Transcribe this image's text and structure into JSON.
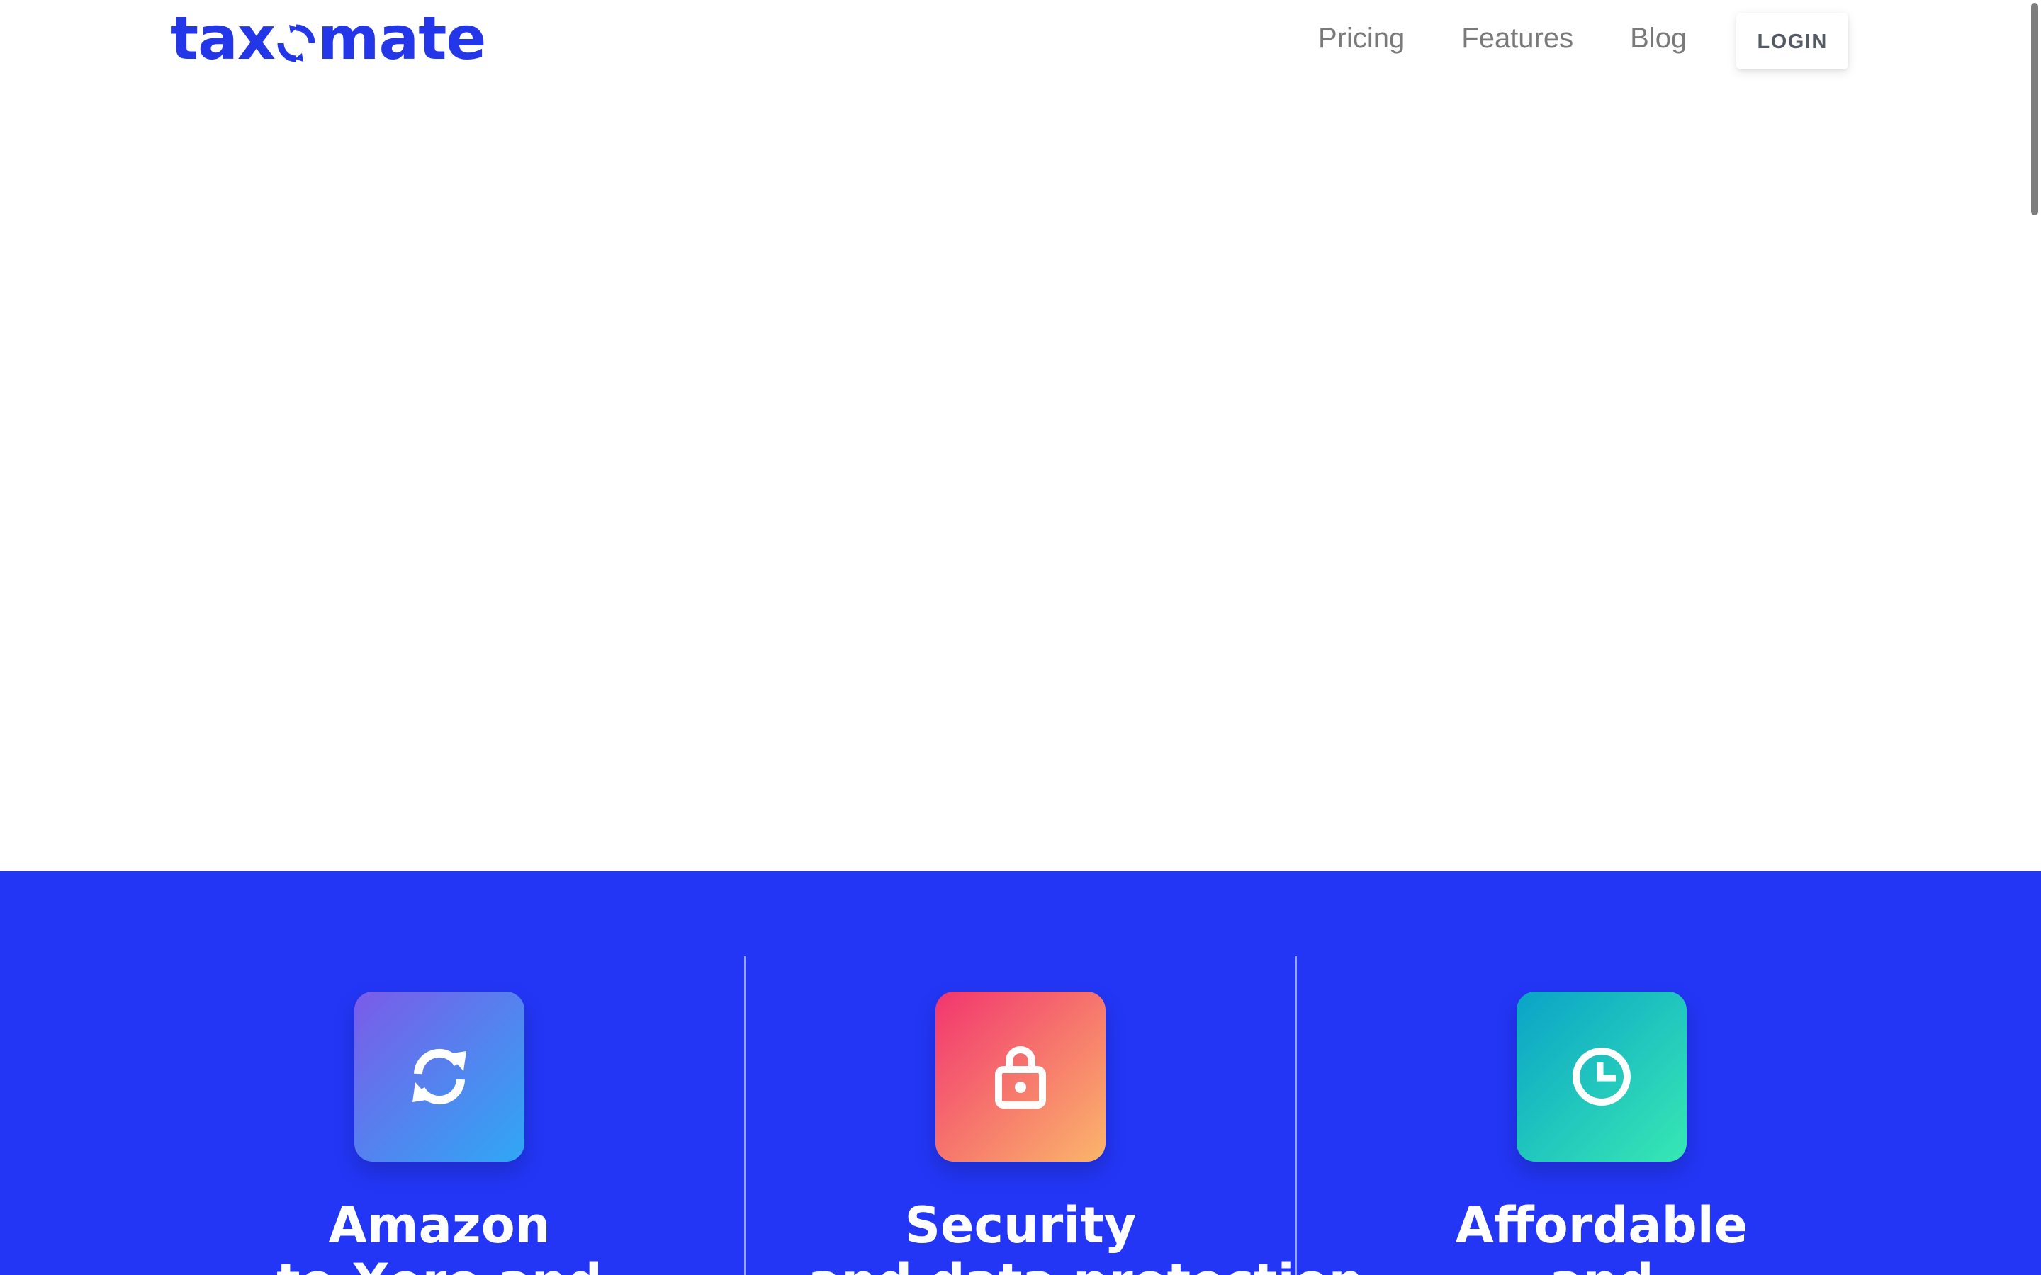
{
  "brand": {
    "logo_text_before": "tax",
    "logo_text_after": "mate",
    "color": "#2336e8"
  },
  "nav": {
    "items": [
      {
        "label": "Pricing"
      },
      {
        "label": "Features"
      },
      {
        "label": "Blog"
      }
    ],
    "login_label": "LOGIN"
  },
  "features": {
    "background": "#2336f5",
    "items": [
      {
        "title": "Amazon",
        "subtitle": "to Xero and",
        "icon": "sync-icon"
      },
      {
        "title": "Security",
        "subtitle": "and data protection",
        "icon": "lock-icon"
      },
      {
        "title": "Affordable",
        "subtitle": "and",
        "icon": "clock-icon"
      }
    ]
  }
}
